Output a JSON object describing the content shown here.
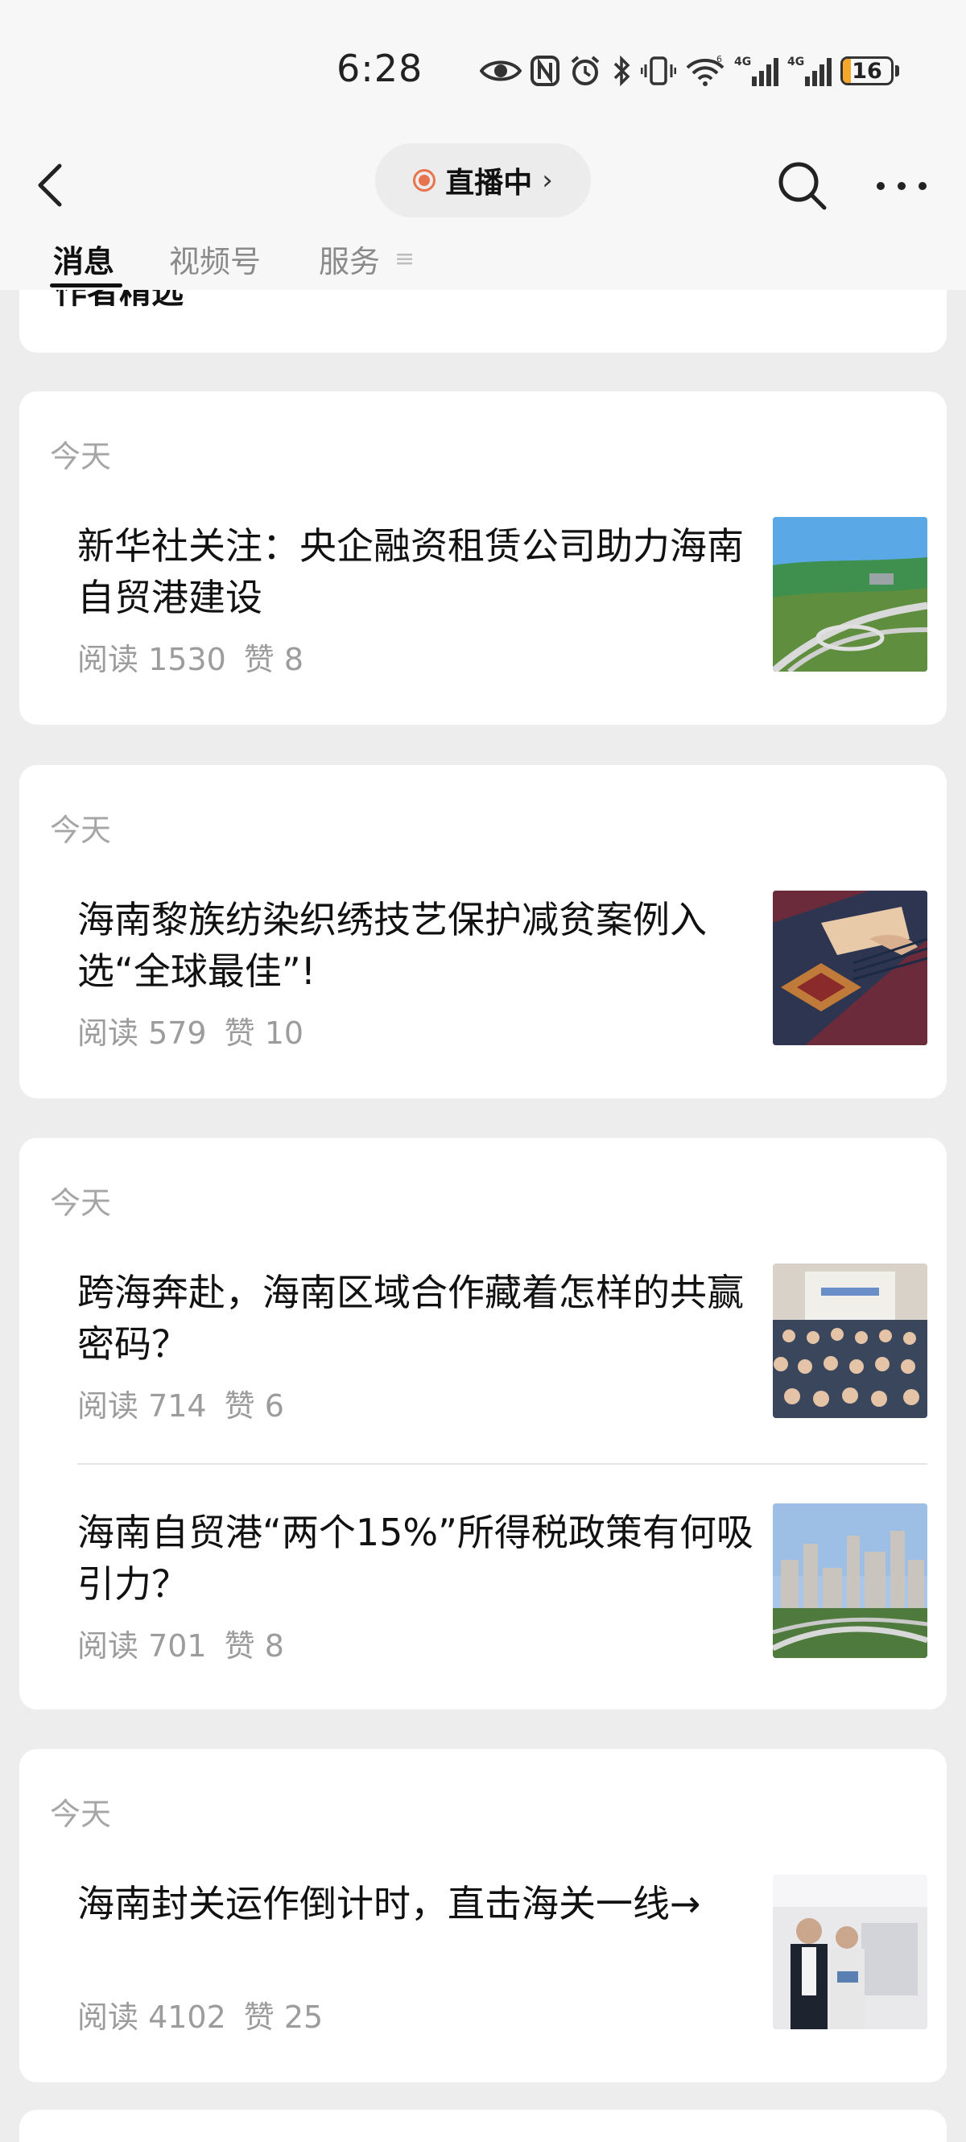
{
  "status": {
    "time": "6:28",
    "battery": "16",
    "battery_level": 0.16,
    "network1": "4G",
    "network2": "4G",
    "wifi_badge": "6"
  },
  "nav": {
    "live_label": "直播中",
    "live_chevron": "›"
  },
  "tabs": [
    {
      "label": "消息"
    },
    {
      "label": "视频号"
    },
    {
      "label": "服务"
    }
  ],
  "tab_menu_glyph": "≡",
  "partial_card": {
    "title": "作者精选"
  },
  "cards": [
    {
      "date": "今天",
      "articles": [
        {
          "title": "新华社关注：央企融资租赁公司助力海南自贸港建设",
          "reads": "阅读 1530",
          "likes": "赞 8"
        }
      ]
    },
    {
      "date": "今天",
      "articles": [
        {
          "title": "海南黎族纺染织绣技艺保护减贫案例入选“全球最佳”!",
          "reads": "阅读 579",
          "likes": "赞 10"
        }
      ]
    },
    {
      "date": "今天",
      "articles": [
        {
          "title": "跨海奔赴，海南区域合作藏着怎样的共赢密码？",
          "reads": "阅读 714",
          "likes": "赞 6"
        },
        {
          "title": "海南自贸港“两个15%”所得税政策有何吸引力？",
          "reads": "阅读 701",
          "likes": "赞 8"
        }
      ]
    },
    {
      "date": "今天",
      "articles": [
        {
          "title": "海南封关运作倒计时，直击海关一线→",
          "reads": "阅读 4102",
          "likes": "赞 25"
        }
      ]
    }
  ],
  "colors": {
    "background": "#ededed",
    "card": "#ffffff",
    "live_accent": "#e8734f",
    "meta_text": "#9c9c9c",
    "battery_fill": "#f4a72a"
  }
}
